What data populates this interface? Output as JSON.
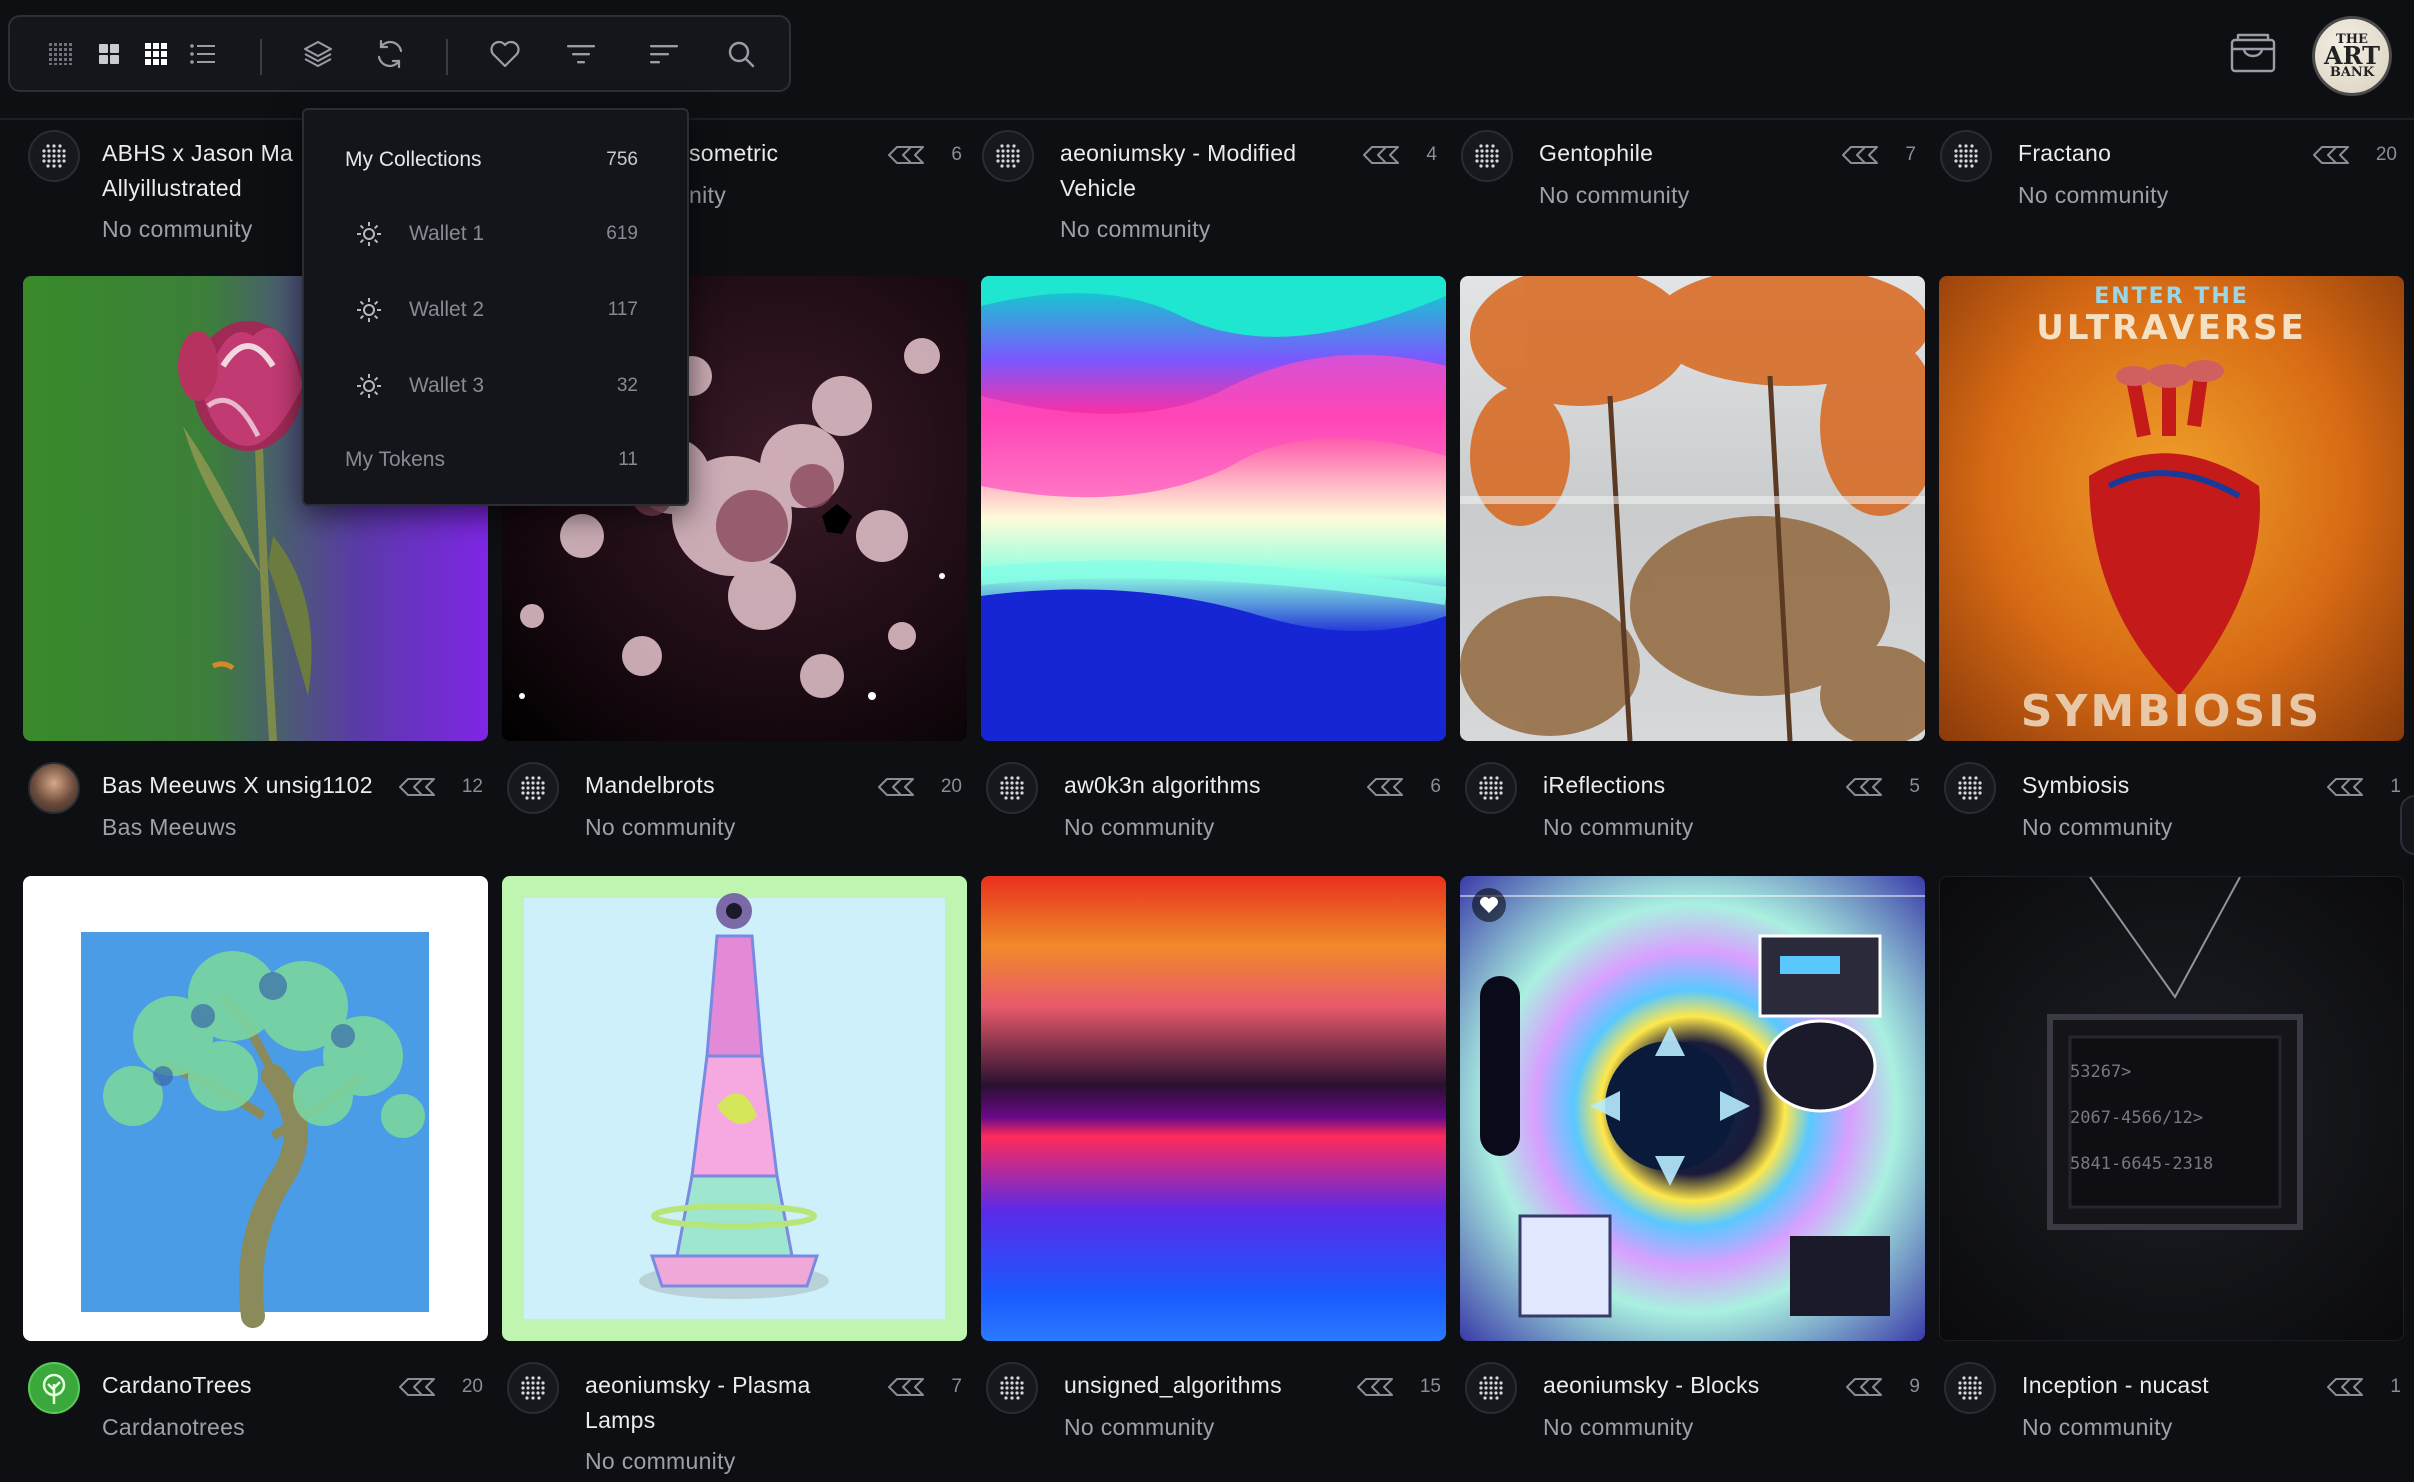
{
  "toolbar": {
    "icons": [
      "grid-dense-icon",
      "grid-large-icon",
      "grid-small-icon",
      "list-view-icon",
      "layers-icon",
      "refresh-icon",
      "heart-icon",
      "filter-icon",
      "sort-icon",
      "search-icon"
    ]
  },
  "header": {
    "logo_lines": [
      "THE",
      "ART",
      "BANK"
    ]
  },
  "dropdown": {
    "collections_label": "My Collections",
    "collections_count": "756",
    "wallets": [
      {
        "label": "Wallet 1",
        "count": "619"
      },
      {
        "label": "Wallet 2",
        "count": "117"
      },
      {
        "label": "Wallet 3",
        "count": "32"
      }
    ],
    "tokens_label": "My Tokens",
    "tokens_count": "11"
  },
  "row0": [
    {
      "title": "ABHS x Jason Ma Allyillustrated",
      "sub": "No community",
      "count": ""
    },
    {
      "title": "sometric",
      "sub": "nity",
      "count": "6"
    },
    {
      "title": "aeoniumsky - Modified Vehicle",
      "sub": "No community",
      "count": "4"
    },
    {
      "title": "Gentophile",
      "sub": "No community",
      "count": "7"
    },
    {
      "title": "Fractano",
      "sub": "No community",
      "count": "20"
    }
  ],
  "row1": [
    {
      "title": "Bas Meeuws X unsig1102",
      "sub": "Bas Meeuws",
      "count": "12"
    },
    {
      "title": "Mandelbrots",
      "sub": "No community",
      "count": "20"
    },
    {
      "title": "aw0k3n algorithms",
      "sub": "No community",
      "count": "6"
    },
    {
      "title": "iReflections",
      "sub": "No community",
      "count": "5"
    },
    {
      "title": "Symbiosis",
      "sub": "No community",
      "count": "1"
    }
  ],
  "row2": [
    {
      "title": "CardanoTrees",
      "sub": "Cardanotrees",
      "count": "20"
    },
    {
      "title": "aeoniumsky - Plasma Lamps",
      "sub": "No community",
      "count": "7"
    },
    {
      "title": "unsigned_algorithms",
      "sub": "No community",
      "count": "15"
    },
    {
      "title": "aeoniumsky - Blocks",
      "sub": "No community",
      "count": "9"
    },
    {
      "title": "Inception - nucast",
      "sub": "No community",
      "count": "1"
    }
  ],
  "art_text": {
    "symbiosis_top": "ENTER THE",
    "symbiosis_mid": "ULTRAVERSE",
    "symbiosis_bottom": "SYMBIOSIS",
    "inception_lines": [
      "53267>",
      "2067-4566/12>",
      "5841-6645-2318"
    ]
  },
  "colors": {
    "background": "#0e0f13",
    "panel": "#14151a",
    "text_primary": "#ececef",
    "text_secondary": "#9ea0a6"
  }
}
